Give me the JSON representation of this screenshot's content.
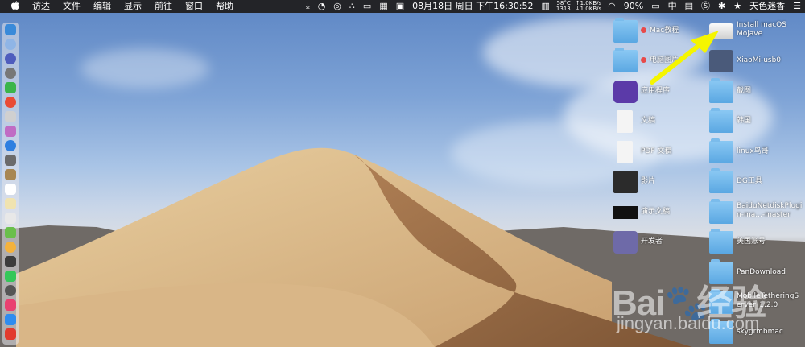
{
  "menubar": {
    "apple_icon": "apple-icon",
    "items": [
      "访达",
      "文件",
      "编辑",
      "显示",
      "前往",
      "窗口",
      "帮助"
    ],
    "status": {
      "datetime": "08月18日 周日 下午16:30:52",
      "temp": "58°C",
      "fan": "1313",
      "net_up": "↑1.0KB/s",
      "net_down": "↓1.0KB/s",
      "battery": "90%",
      "input_method": "中",
      "user": "天色迷香"
    }
  },
  "desktop_icons": [
    {
      "label": "Mac教程",
      "kind": "folder",
      "tag": "red"
    },
    {
      "label": "电脑图片",
      "kind": "folder",
      "tag": "red"
    },
    {
      "label": "应用程序",
      "kind": "app"
    },
    {
      "label": "文稿",
      "kind": "doc"
    },
    {
      "label": "PDF 文稿",
      "kind": "doc"
    },
    {
      "label": "影片",
      "kind": "media"
    },
    {
      "label": "演示文稿",
      "kind": "media"
    },
    {
      "label": "开发者",
      "kind": "app"
    },
    {
      "label": "Install macOS Mojave",
      "kind": "disk"
    },
    {
      "label": "XiaoMi-usb0",
      "kind": "network"
    },
    {
      "label": "截图",
      "kind": "folder"
    },
    {
      "label": "韩国",
      "kind": "folder"
    },
    {
      "label": "linux鸟哥",
      "kind": "folder"
    },
    {
      "label": "DG工具",
      "kind": "folder"
    },
    {
      "label": "BaiduNetdiskPlugin-ma...-master",
      "kind": "folder"
    },
    {
      "label": "美国账号",
      "kind": "folder"
    },
    {
      "label": "PanDownload",
      "kind": "folder"
    },
    {
      "label": "MobileTetheringServer_1.2.0",
      "kind": "folder"
    },
    {
      "label": "skygrmbmac",
      "kind": "folder"
    }
  ],
  "annotation": {
    "arrow_color": "#f5f500"
  },
  "watermark": {
    "brand": "Bai",
    "brand_cn": "经验",
    "url": "jingyan.baidu.com"
  }
}
